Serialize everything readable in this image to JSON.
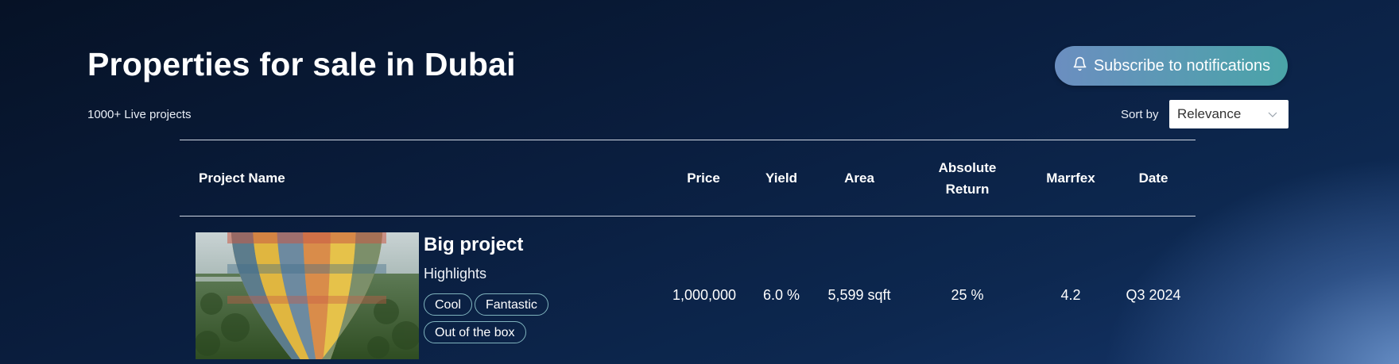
{
  "header": {
    "title": "Properties for sale in Dubai",
    "live_count": "1000+ Live projects",
    "subscribe_label": "Subscribe to notifications",
    "sort_label": "Sort by",
    "sort_value": "Relevance"
  },
  "table": {
    "columns": {
      "project_name": "Project Name",
      "price": "Price",
      "yield": "Yield",
      "area": "Area",
      "absolute_return": "Absolute Return",
      "marrfex": "Marrfex",
      "date": "Date"
    },
    "rows": [
      {
        "name": "Big project",
        "highlights_label": "Highlights",
        "tags": [
          "Cool",
          "Fantastic",
          "Out of the box"
        ],
        "price": "1,000,000",
        "yield": "6.0 %",
        "area": "5,599 sqft",
        "absolute_return": "25 %",
        "marrfex": "4.2",
        "date": "Q3 2024"
      }
    ]
  },
  "icons": {
    "subscribe": "bell-icon",
    "sort": "chevron-down-icon",
    "thumbnail": "hot-air-balloon-image"
  },
  "colors": {
    "background": "#0a1e3f",
    "button_gradient_start": "#6b8ec0",
    "button_gradient_end": "#4aa4a8",
    "tag_border": "#7fb3bd"
  }
}
